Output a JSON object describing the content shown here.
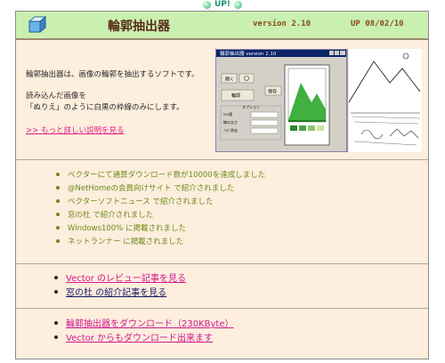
{
  "badge": {
    "label": "UP!"
  },
  "header": {
    "title": "輪郭抽出器",
    "version": "version 2.10",
    "updated": "UP 08/02/10"
  },
  "intro": {
    "line1": "輪郭抽出器は、画像の輪郭を抽出するソフトです。",
    "line2": "読み込んだ画像を",
    "line3": "「ぬりえ」のように白黒の枠線のみにします。",
    "more_link": ">> もっと詳しい説明を見る"
  },
  "screenshot": {
    "window_title": "輪郭抽出器 version 2.10",
    "buttons": [
      "開く",
      "保存",
      "輪郭抽出"
    ],
    "settings_title": "オプション"
  },
  "news": [
    "ベクターにて通算ダウンロード数が10000を達成しました",
    "@NetHomeの会員向けサイト で紹介されました",
    "ベクターソフトニュース で紹介されました",
    "窓の杜 で紹介されました",
    "Windows100% に掲載されました",
    "ネットランナー に掲載されました"
  ],
  "reviews": [
    {
      "text": "Vector のレビュー記事を見る",
      "color": "#d01890"
    },
    {
      "text": "窓の杜 の紹介記事を見る",
      "color": "#1a1a6a"
    }
  ],
  "downloads": [
    {
      "text": "輪郭抽出器をダウンロード（230KByte）",
      "color": "#d01890"
    },
    {
      "text": "Vector からもダウンロード出来ます",
      "color": "#d01890"
    }
  ]
}
